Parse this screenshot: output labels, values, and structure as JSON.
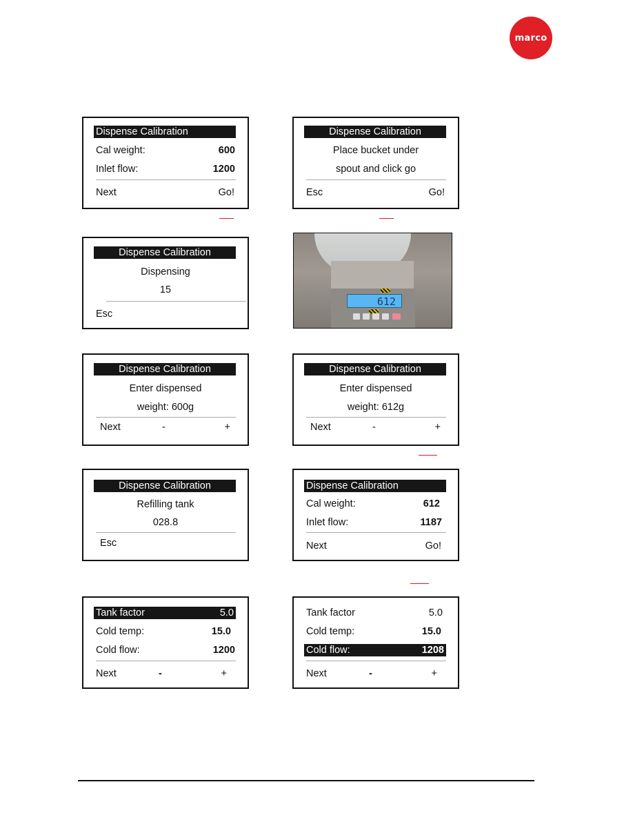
{
  "brand": {
    "logo_text": "marco",
    "color": "#e01f26"
  },
  "screens": {
    "s1": {
      "title": "Dispense Calibration",
      "rows": [
        {
          "label": "Cal weight:",
          "value": "600"
        },
        {
          "label": "Inlet flow:",
          "value": "1200"
        }
      ],
      "footer": {
        "left": "Next",
        "right": "Go!"
      }
    },
    "s2": {
      "title": "Dispense Calibration",
      "lines": [
        "Place bucket under",
        "spout and click go"
      ],
      "footer": {
        "left": "Esc",
        "right": "Go!"
      }
    },
    "s3": {
      "title": "Dispense Calibration",
      "lines": [
        "Dispensing",
        "15"
      ],
      "footer": {
        "left": "Esc"
      }
    },
    "photo": {
      "description": "Bucket on digital scale",
      "scale_reading": "612"
    },
    "s4": {
      "title": "Dispense Calibration",
      "lines": [
        "Enter dispensed",
        "weight: 600g"
      ],
      "footer": {
        "left": "Next",
        "middle": "-",
        "right": "+"
      }
    },
    "s5": {
      "title": "Dispense Calibration",
      "lines": [
        "Enter dispensed",
        "weight: 612g"
      ],
      "footer": {
        "left": "Next",
        "middle": "-",
        "right": "+"
      }
    },
    "s6": {
      "title": "Dispense Calibration",
      "lines": [
        "Refilling tank",
        "028.8"
      ],
      "footer": {
        "left": "Esc"
      }
    },
    "s7": {
      "title": "Dispense Calibration",
      "rows": [
        {
          "label": "Cal weight:",
          "value": "612"
        },
        {
          "label": "Inlet flow:",
          "value": "1187"
        }
      ],
      "footer": {
        "left": "Next",
        "right": "Go!"
      }
    },
    "s8": {
      "rows": [
        {
          "label": "Tank factor",
          "value": "5.0"
        },
        {
          "label": "Cold temp:",
          "value": "15.0"
        },
        {
          "label": "Cold flow:",
          "value": "1200"
        }
      ],
      "highlighted_row": "Tank factor",
      "footer": {
        "left": "Next",
        "middle": "-",
        "right": "+"
      }
    },
    "s9": {
      "rows": [
        {
          "label": "Tank factor",
          "value": "5.0"
        },
        {
          "label": "Cold temp:",
          "value": "15.0"
        },
        {
          "label": "Cold flow:",
          "value": "1208"
        }
      ],
      "highlighted_row": "Cold flow:",
      "footer": {
        "left": "Next",
        "middle": "-",
        "right": "+"
      }
    }
  },
  "accent_marks_color": "#d81e1e"
}
